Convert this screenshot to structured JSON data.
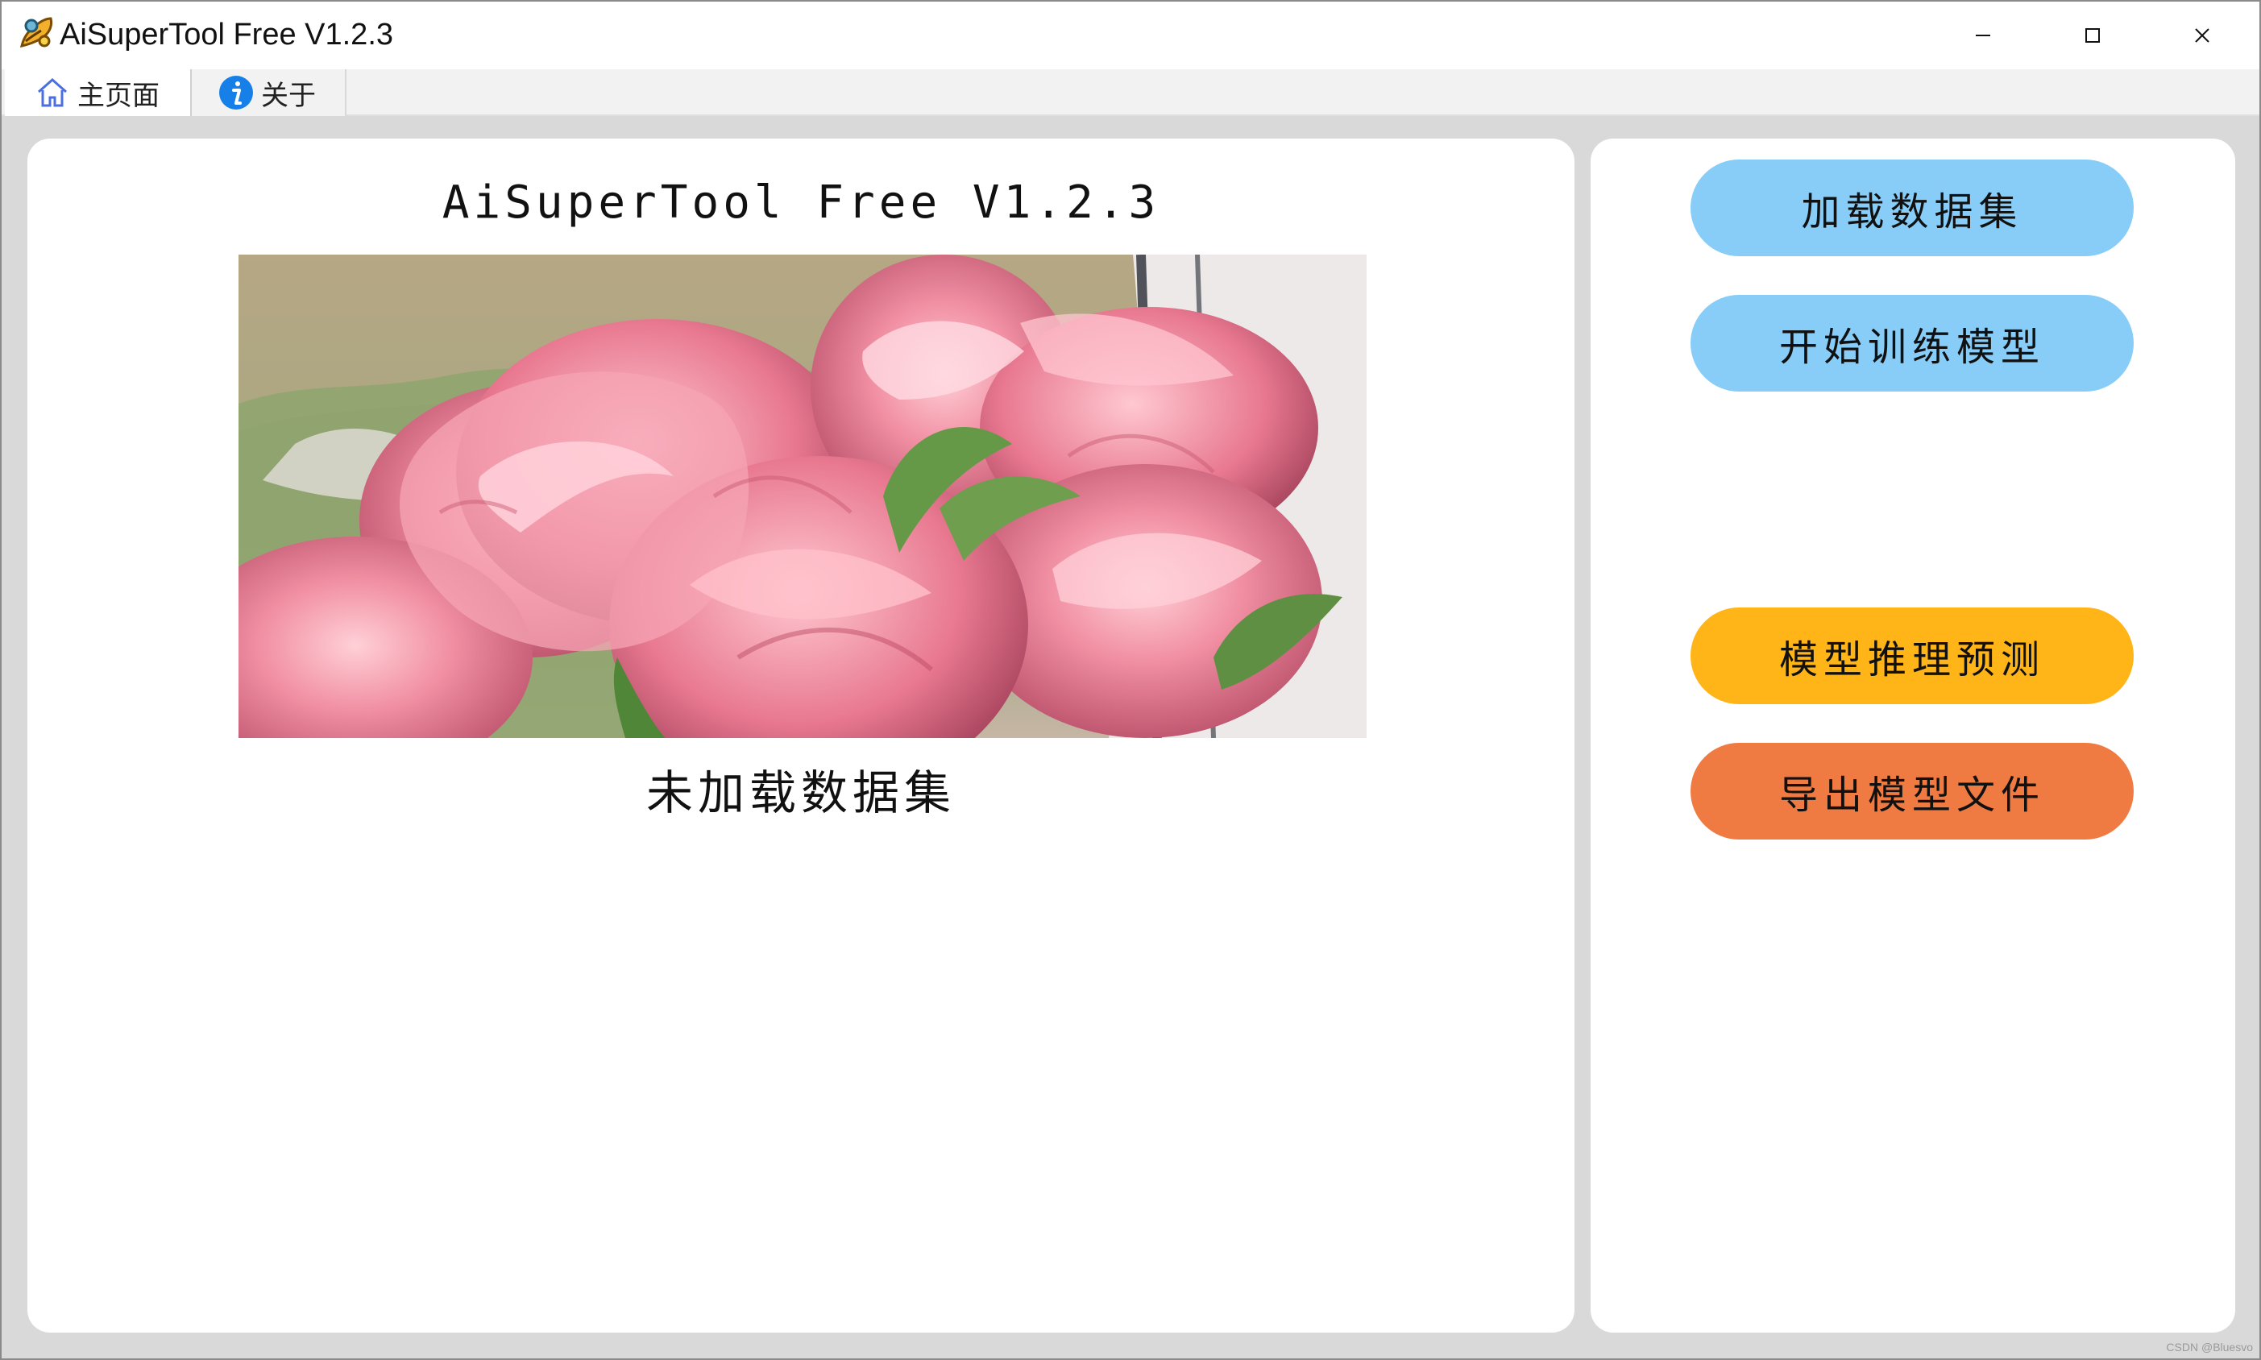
{
  "window": {
    "title": "AiSuperTool Free V1.2.3",
    "controls": {
      "minimize_icon": "minimize-icon",
      "maximize_icon": "maximize-icon",
      "close_icon": "close-icon"
    }
  },
  "tabs": [
    {
      "label": "主页面",
      "icon": "home-icon",
      "selected": true
    },
    {
      "label": "关于",
      "icon": "info-icon",
      "selected": false
    }
  ],
  "main": {
    "title": "AiSuperTool Free V1.2.3",
    "image": {
      "subject": "pink roses"
    },
    "status": "未加载数据集"
  },
  "actions": [
    {
      "label": "加载数据集",
      "color": "#87cdf8"
    },
    {
      "label": "开始训练模型",
      "color": "#87cdf8"
    },
    {
      "label": "模型推理预测",
      "color": "#ffb418"
    },
    {
      "label": "导出模型文件",
      "color": "#ef7b43"
    }
  ],
  "watermark": "CSDN @Bluesvo",
  "colors": {
    "background": "#d9d9d9",
    "panel": "#ffffff",
    "blue_button": "#87cdf8",
    "yellow_button": "#ffb418",
    "orange_button": "#ef7b43"
  }
}
